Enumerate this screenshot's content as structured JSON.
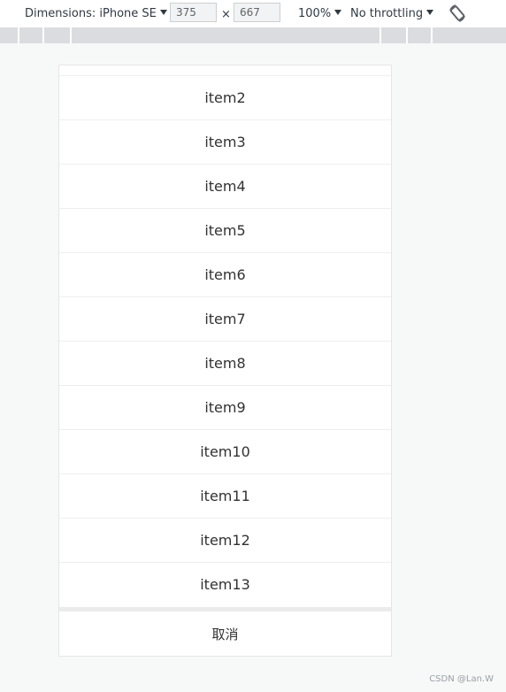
{
  "toolbar": {
    "dimensions_label": "Dimensions: iPhone SE",
    "width_value": "375",
    "times_sign": "×",
    "height_value": "667",
    "zoom_label": "100%",
    "throttling_label": "No throttling",
    "rotate_icon": "rotate-icon"
  },
  "action_sheet": {
    "items": [
      "item2",
      "item3",
      "item4",
      "item5",
      "item6",
      "item7",
      "item8",
      "item9",
      "item10",
      "item11",
      "item12",
      "item13"
    ],
    "cancel_label": "取消"
  },
  "watermark": "CSDN @Lan.W"
}
